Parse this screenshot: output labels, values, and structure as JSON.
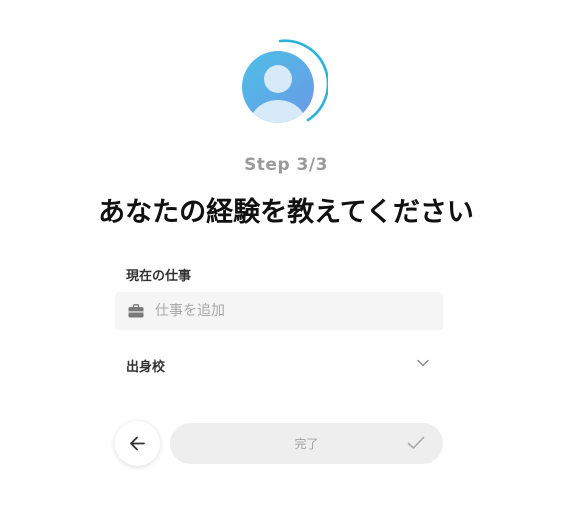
{
  "colors": {
    "accent": "#2bb3d8",
    "avatar_gradient_start": "#4cc0e6",
    "avatar_gradient_end": "#6b9be8",
    "button_disabled_bg": "#eeeeee",
    "input_bg": "#f5f5f5"
  },
  "progress": {
    "current_step": 3,
    "total_steps": 3,
    "step_label": "Step 3/3"
  },
  "header": {
    "title": "あなたの経験を教えてください"
  },
  "form": {
    "job": {
      "label": "現在の仕事",
      "value": "",
      "placeholder": "仕事を追加",
      "icon": "briefcase-icon"
    },
    "school": {
      "label": "出身校",
      "selected": "",
      "icon": "chevron-down-icon"
    }
  },
  "actions": {
    "back_icon": "arrow-left-icon",
    "finish_label": "完了",
    "finish_icon": "check-icon"
  }
}
